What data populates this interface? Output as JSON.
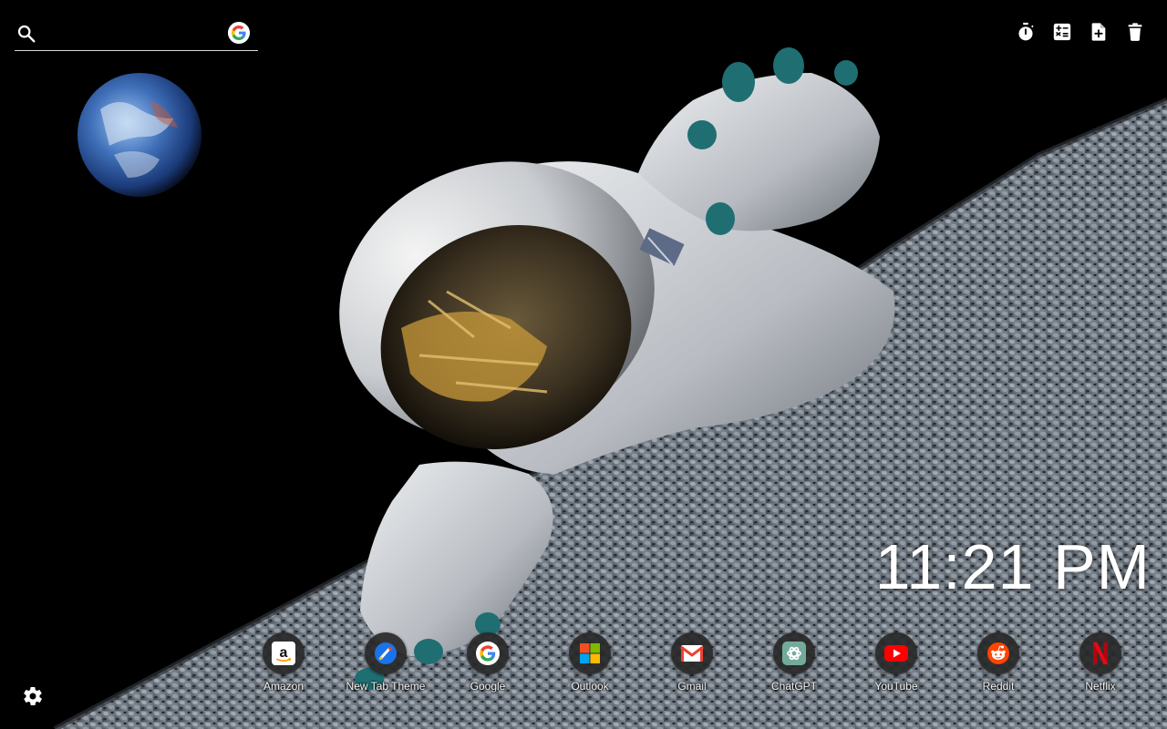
{
  "search": {
    "placeholder": "",
    "value": "",
    "icon": "search-icon",
    "engine_icon": "google-logo-icon"
  },
  "toolbar": {
    "items": [
      {
        "name": "timer",
        "icon": "stopwatch-icon"
      },
      {
        "name": "calculator",
        "icon": "calculator-icon"
      },
      {
        "name": "new-note",
        "icon": "note-add-icon"
      },
      {
        "name": "delete",
        "icon": "trash-icon"
      }
    ]
  },
  "clock": {
    "time": "11:21 PM"
  },
  "shortcuts": [
    {
      "label": "Amazon",
      "icon": "amazon-icon"
    },
    {
      "label": "New Tab Theme",
      "icon": "new-tab-theme-icon"
    },
    {
      "label": "Google",
      "icon": "google-icon"
    },
    {
      "label": "Outlook",
      "icon": "microsoft-icon"
    },
    {
      "label": "Gmail",
      "icon": "gmail-icon"
    },
    {
      "label": "ChatGPT",
      "icon": "chatgpt-icon"
    },
    {
      "label": "YouTube",
      "icon": "youtube-icon"
    },
    {
      "label": "Reddit",
      "icon": "reddit-icon"
    },
    {
      "label": "Netflix",
      "icon": "netflix-icon"
    }
  ],
  "settings": {
    "icon": "gear-icon"
  },
  "colors": {
    "background": "#000000",
    "text": "#ffffff",
    "circle": "#282828",
    "google_blue": "#4285F4",
    "google_red": "#EA4335",
    "google_yellow": "#FBBC05",
    "google_green": "#34A853",
    "youtube_red": "#FF0000",
    "reddit_orange": "#FF4500",
    "netflix_red": "#E50914"
  }
}
